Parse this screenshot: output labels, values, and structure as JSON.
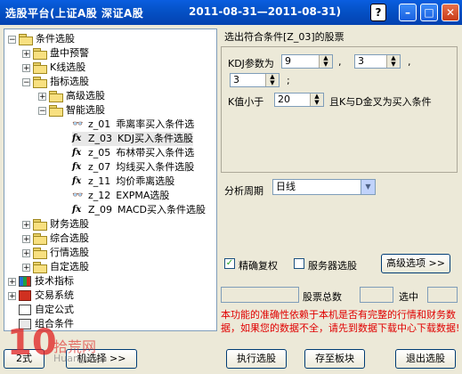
{
  "window": {
    "title": "选股平台(上证A股 深证A股",
    "date_range": "2011-08-31—2011-08-31)",
    "help_label": "?"
  },
  "tree": {
    "root": "条件选股",
    "items": [
      {
        "label": "盘中预警"
      },
      {
        "label": "K线选股"
      },
      {
        "label": "指标选股"
      },
      {
        "label": "高级选股"
      },
      {
        "label": "智能选股"
      },
      {
        "code": "z_01",
        "label": "乖离率买入条件选"
      },
      {
        "code": "Z_03",
        "label": "KDJ买入条件选股"
      },
      {
        "code": "z_05",
        "label": "布林带买入条件选"
      },
      {
        "code": "z_07",
        "label": "均线买入条件选股"
      },
      {
        "code": "z_11",
        "label": "均价乖离选股"
      },
      {
        "code": "z_12",
        "label": "EXPMA选股"
      },
      {
        "code": "Z_09",
        "label": "MACD买入条件选股"
      },
      {
        "label": "财务选股"
      },
      {
        "label": "综合选股"
      },
      {
        "label": "行情选股"
      },
      {
        "label": "自定选股"
      }
    ],
    "bottom": [
      {
        "label": "技术指标"
      },
      {
        "label": "交易系统"
      },
      {
        "label": "自定公式"
      },
      {
        "label": "组合条件"
      }
    ]
  },
  "panel": {
    "header": "选出符合条件[Z_03]的股票",
    "kdj_label": "KDJ参数为",
    "param1": "9",
    "param2": "3",
    "param3": "3",
    "comma": ",",
    "semicolon": ";",
    "k_label": "K值小于",
    "k_value": "20",
    "k_desc": "且K与D金叉为买入条件",
    "period_label": "分析周期",
    "period_value": "日线"
  },
  "options": {
    "precise_label": "精确复权",
    "precise_checked": true,
    "server_label": "服务器选股",
    "server_checked": false,
    "advanced_button": "高级选项 >>"
  },
  "status": {
    "total_label": "股票总数",
    "selected_label": "选中"
  },
  "warning": "本功能的准确性依赖于本机是否有完整的行情和财务数据，如果您的数据不全，请先到数据下载中心下载数据!",
  "buttons": {
    "execute": "执行选股",
    "save": "存至板块",
    "exit": "退出选股",
    "left_partial": "2式",
    "left_more": "机选择 >>"
  },
  "watermark": {
    "number": "10",
    "name": "拾荒网",
    "site": "Huangw.cn"
  }
}
